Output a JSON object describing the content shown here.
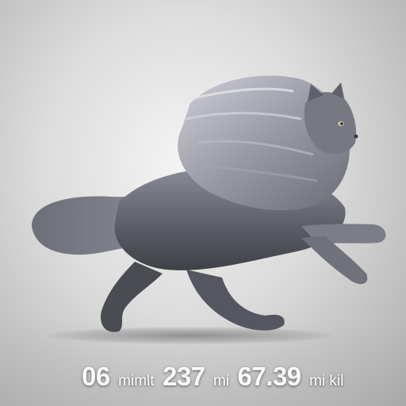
{
  "caption": {
    "value_1": "06",
    "unit_1": "mimlt",
    "value_2": "237",
    "unit_2": "mi",
    "value_3": "67.39",
    "unit_3": "mi kil"
  },
  "colors": {
    "background": "#dcdcdc",
    "fur_dark": "#4b4d55",
    "fur_mid": "#7a7c86",
    "fur_light": "#c9c9d2",
    "caption_text": "#fafafa"
  },
  "subject": "running-long-haired-gray-cat"
}
